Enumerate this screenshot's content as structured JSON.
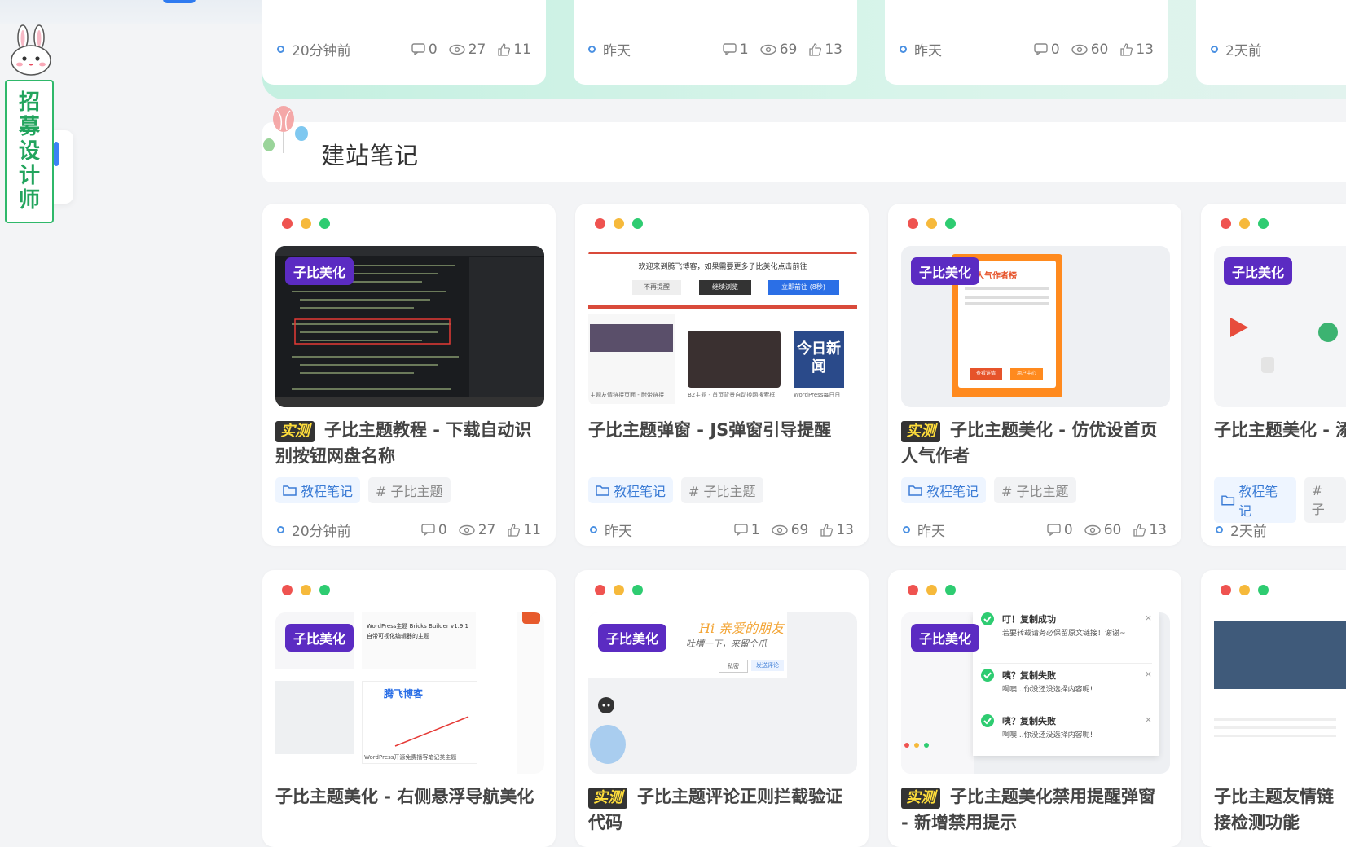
{
  "recruit": {
    "label": [
      "招",
      "募",
      "设",
      "计",
      "师"
    ]
  },
  "section": {
    "title": "建站笔记"
  },
  "top_row": [
    {
      "time": "20分钟前",
      "comments": "0",
      "views": "27",
      "likes": "11"
    },
    {
      "time": "昨天",
      "comments": "1",
      "views": "69",
      "likes": "13"
    },
    {
      "time": "昨天",
      "comments": "0",
      "views": "60",
      "likes": "13"
    },
    {
      "time": "2天前",
      "comments": "",
      "views": "",
      "likes": ""
    }
  ],
  "cards": [
    {
      "badge": "子比美化",
      "test": "实测",
      "title": "子比主题教程 - 下载自动识别按钮网盘名称",
      "tag1": "教程笔记",
      "tag2": "# 子比主题",
      "time": "20分钟前",
      "comments": "0",
      "views": "27",
      "likes": "11"
    },
    {
      "badge": "",
      "test": "",
      "title": "子比主题弹窗 - JS弹窗引导提醒",
      "tag1": "教程笔记",
      "tag2": "# 子比主题",
      "time": "昨天",
      "comments": "1",
      "views": "69",
      "likes": "13",
      "thumb_text": {
        "notice": "欢迎来到腾飞博客，如果需要更多子比美化点击前往",
        "btn1": "不再提醒",
        "btn2": "继续浏览",
        "btn3": "立即前往 (8秒)",
        "cap1": "主题友情链接页面 - 耐带链接",
        "cap2": "B2主题 - 首页背景自动换网搜索框",
        "cap3": "WordPress每日日T",
        "news": "今日新闻"
      }
    },
    {
      "badge": "子比美化",
      "test": "实测",
      "title": "子比主题美化 - 仿优设首页人气作者",
      "tag1": "教程笔记",
      "tag2": "# 子比主题",
      "time": "昨天",
      "comments": "0",
      "views": "60",
      "likes": "13",
      "thumb_text": {
        "head": "人气作者榜",
        "btn1": "查看详情",
        "btn2": "用户中心"
      }
    },
    {
      "badge": "子比美化",
      "test": "",
      "title": "子比主题美化 - 添加背景图",
      "tag1": "教程笔记",
      "tag2": "# 子",
      "time": "2天前",
      "comments": "",
      "views": "",
      "likes": ""
    },
    {
      "badge": "子比美化",
      "test": "",
      "title": "子比主题美化 - 右侧悬浮导航美化",
      "thumb_text": {
        "t1": "WordPress主题 Bricks Builder v1.9.1",
        "t2": "自带可视化编辑器的主题",
        "brand": "腾飞博客",
        "cap": "WordPress开源免费播客笔记类主题"
      }
    },
    {
      "badge": "子比美化",
      "test": "实测",
      "title": "子比主题评论正则拦截验证代码",
      "thumb_text": {
        "hi": "Hi 亲爱的朋友",
        "sub": "吐槽一下，来留个爪",
        "b1": "私密",
        "b2": "发送评论"
      }
    },
    {
      "badge": "子比美化",
      "test": "实测",
      "title": "子比主题美化禁用提醒弹窗 - 新增禁用提示",
      "toasts": [
        {
          "title": "叮！复制成功",
          "body": "若要转载请务必保留原文链接！谢谢~",
          "ok": true
        },
        {
          "title": "咦？复制失败",
          "body": "啊噢...你没还没选择内容呢!",
          "ok": true
        },
        {
          "title": "咦？复制失败",
          "body": "啊噢...你没还没选择内容呢!",
          "ok": true
        }
      ]
    },
    {
      "badge": "",
      "test": "",
      "title": "子比主题友情链接检测功能"
    }
  ],
  "colors": {
    "accent": "#5b2bc2",
    "green": "#2fb86a",
    "blue": "#3a7bd5"
  }
}
